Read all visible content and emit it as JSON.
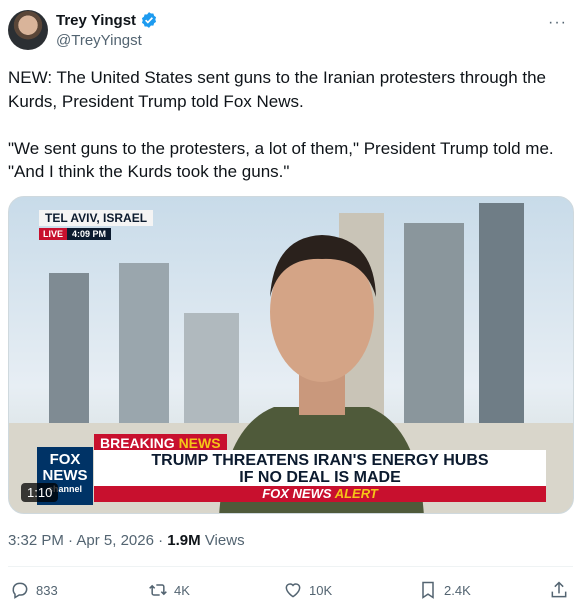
{
  "author": {
    "name": "Trey Yingst",
    "handle": "@TreyYingst"
  },
  "tweet": {
    "text": "NEW: The United States sent guns to the Iranian protesters through the Kurds, President Trump told Fox News.\n\n\"We sent guns to the protesters, a lot of them,\" President Trump told me. \"And I think the Kurds took the guns.\""
  },
  "media": {
    "location": "TEL AVIV, ISRAEL",
    "live": "LIVE",
    "time": "4:09 PM",
    "breaking": "BREAKING",
    "breaking_news": "NEWS",
    "headline_line1": "TRUMP THREATENS IRAN'S ENERGY HUBS",
    "headline_line2": "IF NO DEAL IS MADE",
    "alert_brand": "FOX NEWS",
    "alert_word": "ALERT",
    "logo_line1": "FOX",
    "logo_line2": "NEWS",
    "logo_line3": "channel",
    "duration": "1:10"
  },
  "meta": {
    "time": "3:32 PM",
    "date": "Apr 5, 2026",
    "views_count": "1.9M",
    "views_label": "Views"
  },
  "actions": {
    "replies": "833",
    "reposts": "4K",
    "likes": "10K",
    "bookmarks": "2.4K"
  },
  "icons": {
    "verified": "verified-badge-icon",
    "more": "more-icon",
    "reply": "reply-icon",
    "repost": "repost-icon",
    "like": "heart-icon",
    "bookmark": "bookmark-icon",
    "share": "share-icon"
  },
  "colors": {
    "verified": "#1d9bf0",
    "text": "#0f1419",
    "secondary": "#536471",
    "fox_red": "#c8102e",
    "fox_navy": "#003366"
  }
}
